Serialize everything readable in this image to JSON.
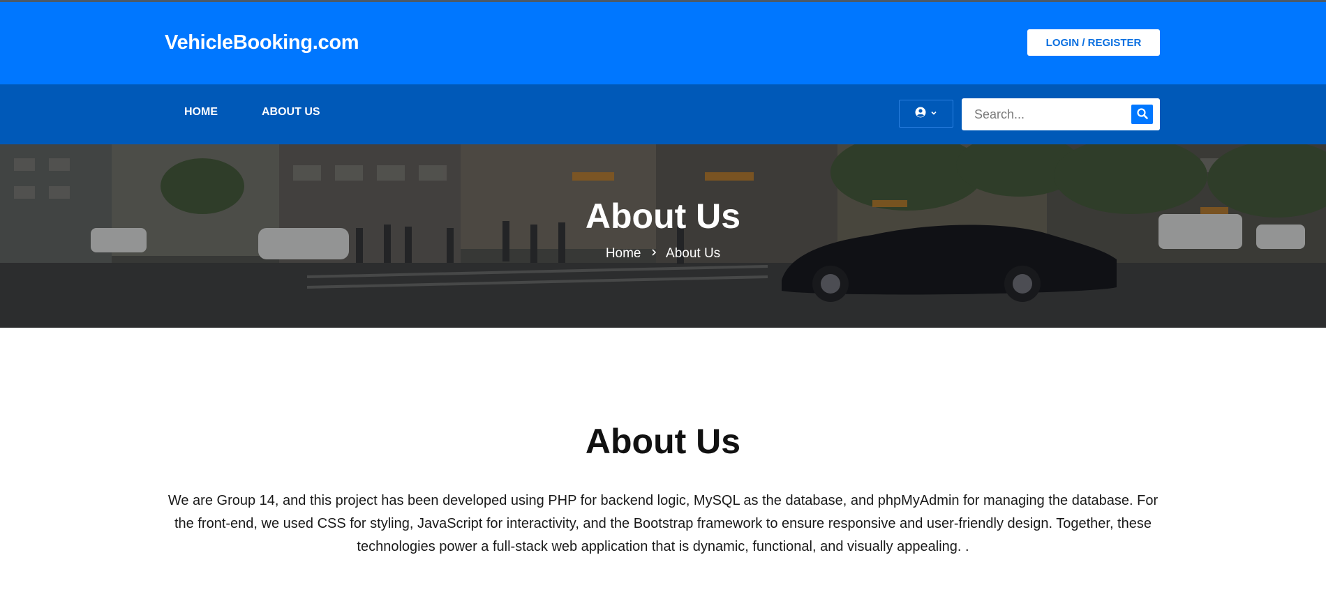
{
  "header": {
    "logo": "VehicleBooking.com",
    "login_label": "LOGIN / REGISTER"
  },
  "nav": {
    "items": [
      {
        "label": "HOME"
      },
      {
        "label": "ABOUT US"
      }
    ],
    "user_icon": "user-circle-icon",
    "search": {
      "placeholder": "Search...",
      "value": "",
      "icon": "search-icon"
    }
  },
  "hero": {
    "title": "About Us",
    "breadcrumb": {
      "home": "Home",
      "current": "About Us"
    }
  },
  "content": {
    "title": "About Us",
    "body": "We are Group 14, and this project has been developed using PHP for backend logic, MySQL as the database, and phpMyAdmin for managing the database. For the front-end, we used CSS for styling, JavaScript for interactivity, and the Bootstrap framework to ensure responsive and user-friendly design. Together, these technologies power a full-stack web application that is dynamic, functional, and visually appealing. ."
  },
  "colors": {
    "header_bg": "#0077ff",
    "nav_bg": "#0059b8",
    "accent": "#0077ff"
  }
}
